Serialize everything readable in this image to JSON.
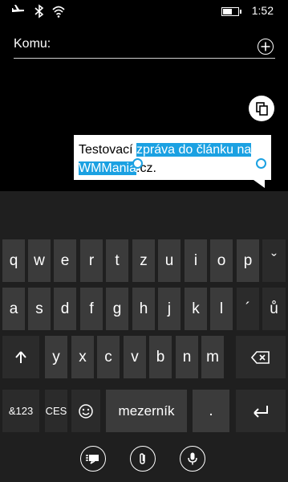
{
  "status_bar": {
    "time": "1:52",
    "battery_level": 0.6,
    "icons": [
      "airplane-mode-icon",
      "bluetooth-icon",
      "wifi-icon"
    ]
  },
  "compose": {
    "to_label": "Komu:",
    "add_recipient_icon": "plus-icon",
    "paste_icon": "paste-icon"
  },
  "message": {
    "text_before": "Testovací ",
    "text_selected_1": "zpráva do článku na",
    "text_selected_2": "WMMania",
    "text_after": ".cz."
  },
  "keyboard": {
    "row1": [
      "q",
      "w",
      "e",
      "r",
      "t",
      "z",
      "u",
      "i",
      "o",
      "p",
      "ˇ"
    ],
    "row2": [
      "a",
      "s",
      "d",
      "f",
      "g",
      "h",
      "j",
      "k",
      "l",
      "´",
      "ů"
    ],
    "row3": [
      "y",
      "x",
      "c",
      "v",
      "b",
      "n",
      "m"
    ],
    "shift_icon": "shift-arrow-icon",
    "backspace_icon": "backspace-icon",
    "numbers_label": "&123",
    "language_label": "CES",
    "emoji_icon": "emoji-icon",
    "space_label": "mezerník",
    "period_label": ".",
    "enter_icon": "enter-icon"
  },
  "app_bar": {
    "icons": [
      "sms-toggle-icon",
      "attach-icon",
      "microphone-icon"
    ]
  }
}
